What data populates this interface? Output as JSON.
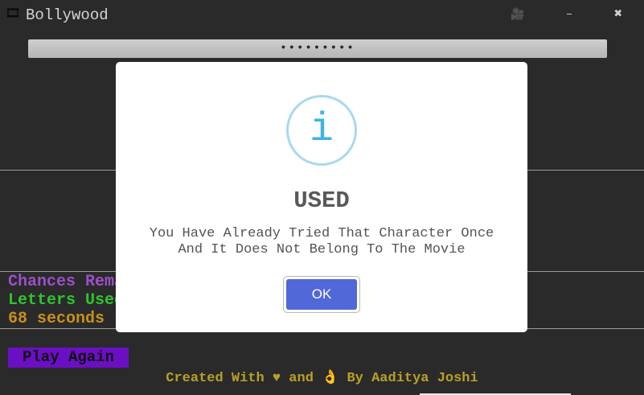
{
  "window": {
    "title": "Bollywood",
    "app_icon": "film-reel-icon",
    "app_icon_glyph": "🎞",
    "camera_glyph": "🎥",
    "minimize_glyph": "–",
    "close_glyph": "✖"
  },
  "game": {
    "masked_movie": "•••••••••",
    "chances_label": "Chances Rema",
    "letters_label": "Letters Used",
    "timer_text": "68 seconds",
    "play_again_label": "Play Again"
  },
  "footer": {
    "credit": "Created With ♥ and 👌 By Aaditya Joshi"
  },
  "dialog": {
    "icon": "info-icon",
    "icon_glyph": "i",
    "title": "USED",
    "message_line1": "You Have Already Tried That Character Once",
    "message_line2": "And It Does Not Belong To The Movie",
    "ok_label": "OK"
  },
  "colors": {
    "background": "#2a2a2a",
    "chances": "#9b4fc9",
    "letters": "#2ec42e",
    "timer": "#c8901c",
    "play_again_bg": "#6a0fc4",
    "footer": "#b8a027",
    "ok_button": "#5168d8",
    "info_icon": "#3fb3e6"
  }
}
